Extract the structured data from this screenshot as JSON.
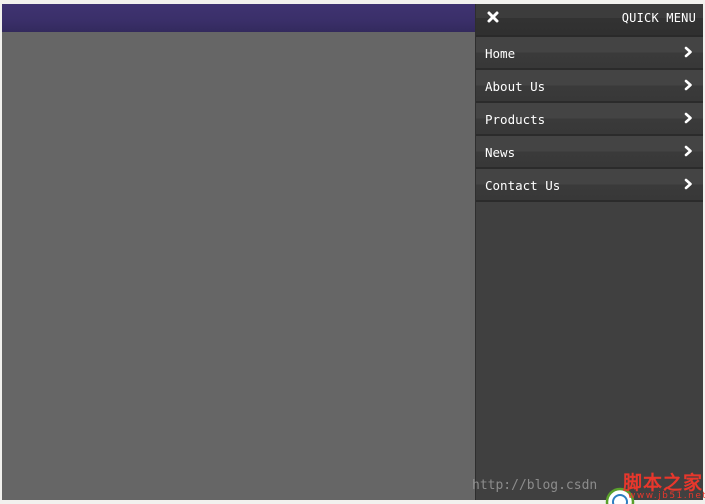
{
  "menu": {
    "title": "QUICK MENU",
    "items": [
      {
        "label": "Home"
      },
      {
        "label": "About Us"
      },
      {
        "label": "Products"
      },
      {
        "label": "News"
      },
      {
        "label": "Contact Us"
      }
    ]
  },
  "watermark": {
    "url": "http://blog.csdn",
    "logo_text": "脚本之家",
    "logo_domain": "www.jb51.net"
  },
  "icons": {
    "close": "close-icon",
    "chevron": "chevron-right-icon",
    "logo": "site-logo-icon"
  },
  "colors": {
    "top_bar": "#3a2f69",
    "page_background": "#666666",
    "menu_background": "#404040",
    "logo_red": "#e8372c"
  }
}
